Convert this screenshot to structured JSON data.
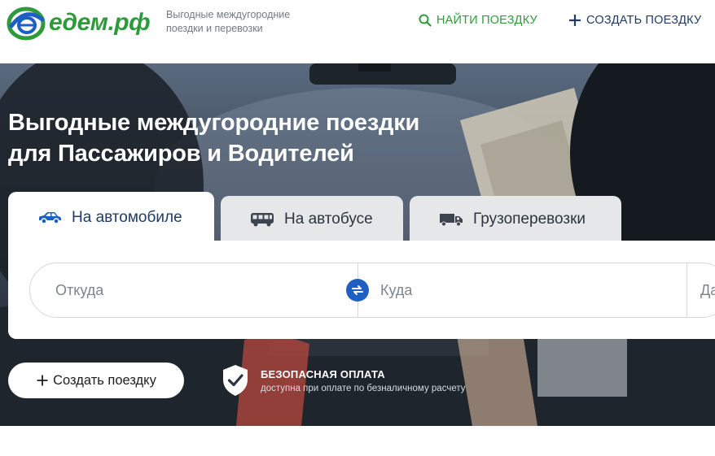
{
  "header": {
    "logo_text": "едем.рф",
    "tagline": "Выгодные междугородние поездки и перевозки",
    "nav": {
      "find_trip": "НАЙТИ ПОЕЗДКУ",
      "create_trip": "СОЗДАТЬ ПОЕЗДКУ"
    }
  },
  "hero": {
    "title_line1": "Выгодные междугородние поездки",
    "title_line2": "для Пассажиров и Водителей"
  },
  "tabs": [
    {
      "label": "На автомобиле",
      "icon": "car-icon",
      "active": true
    },
    {
      "label": "На автобусе",
      "icon": "bus-icon",
      "active": false
    },
    {
      "label": "Грузоперевозки",
      "icon": "truck-icon",
      "active": false
    }
  ],
  "search": {
    "from_placeholder": "Откуда",
    "to_placeholder": "Куда",
    "date_placeholder": "Да"
  },
  "actions": {
    "create_trip": "Создать поездку"
  },
  "secure_payment": {
    "title": "БЕЗОПАСНАЯ ОПЛАТА",
    "subtitle": "доступна при оплате по безналичному расчету"
  },
  "colors": {
    "brand_green": "#2f9a3c",
    "brand_blue": "#1e5fc3",
    "navy": "#1f3b63"
  }
}
